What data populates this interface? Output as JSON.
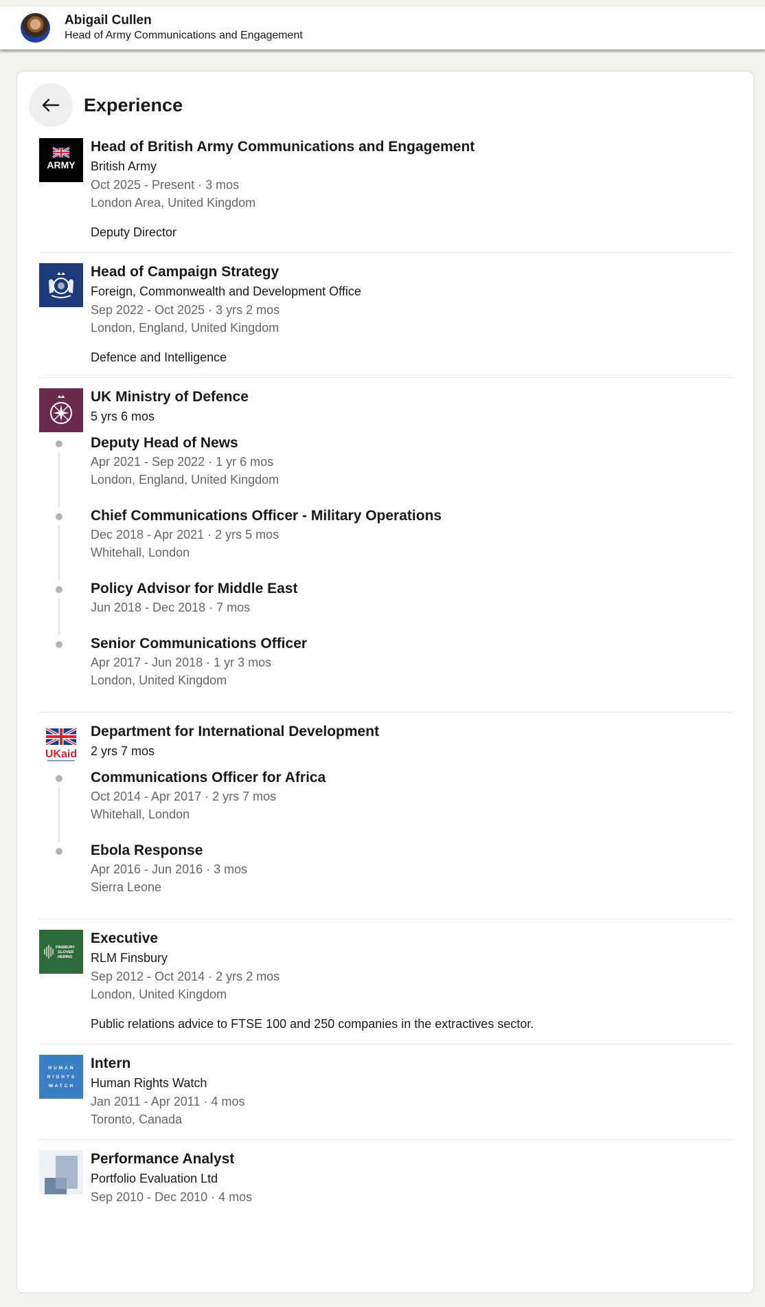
{
  "profile": {
    "name": "Abigail Cullen",
    "headline": "Head of Army Communications and Engagement"
  },
  "section": {
    "title": "Experience"
  },
  "experiences": [
    {
      "role": "Head of British Army Communications and Engagement",
      "company": "British Army",
      "dates": "Oct 2025 - Present · 3 mos",
      "location": "London Area, United Kingdom",
      "description": "Deputy Director",
      "logo_text": "ARMY"
    },
    {
      "role": "Head of Campaign Strategy",
      "company": "Foreign, Commonwealth and Development Office",
      "dates": "Sep 2022 - Oct 2025 · 3 yrs 2 mos",
      "location": "London, England, United Kingdom",
      "description": "Defence and Intelligence"
    },
    {
      "company": "UK Ministry of Defence",
      "duration": "5 yrs 6 mos",
      "positions": [
        {
          "role": "Deputy Head of News",
          "dates": "Apr 2021 - Sep 2022 · 1 yr 6 mos",
          "location": "London, England, United Kingdom"
        },
        {
          "role": "Chief Communications Officer - Military Operations",
          "dates": "Dec 2018 - Apr 2021 · 2 yrs 5 mos",
          "location": "Whitehall, London"
        },
        {
          "role": "Policy Advisor for Middle East",
          "dates": "Jun 2018 - Dec 2018 · 7 mos"
        },
        {
          "role": "Senior Communications Officer",
          "dates": "Apr 2017 - Jun 2018 · 1 yr 3 mos",
          "location": "London, United Kingdom"
        }
      ]
    },
    {
      "company": "Department for International Development",
      "duration": "2 yrs 7 mos",
      "logo_text": "UKaid",
      "positions": [
        {
          "role": "Communications Officer for Africa",
          "dates": "Oct 2014 - Apr 2017 · 2 yrs 7 mos",
          "location": "Whitehall, London"
        },
        {
          "role": "Ebola Response",
          "dates": "Apr 2016 - Jun 2016 · 3 mos",
          "location": "Sierra Leone"
        }
      ]
    },
    {
      "role": "Executive",
      "company": "RLM Finsbury",
      "dates": "Sep 2012 - Oct 2014 · 2 yrs 2 mos",
      "location": "London, United Kingdom",
      "description": "Public relations advice to FTSE 100 and 250 companies in the extractives sector.",
      "logo_text": [
        "FINSBURY",
        "GLOVER",
        "HERING"
      ]
    },
    {
      "role": "Intern",
      "company": "Human Rights Watch",
      "dates": "Jan 2011 - Apr 2011 · 4 mos",
      "location": "Toronto, Canada",
      "logo_text": [
        "HUMAN",
        "RIGHTS",
        "WATCH"
      ]
    },
    {
      "role": "Performance Analyst",
      "company": "Portfolio Evaluation Ltd",
      "dates": "Sep 2010 - Dec 2010 · 4 mos"
    }
  ],
  "colors": {
    "army_logo_bg": "#000000",
    "fcdo_logo_bg": "#1d3b7a",
    "mod_logo_bg": "#6a2b4a",
    "finsbury_logo_bg": "#2e6b3a",
    "hrw_logo_bg": "#3a7ec4",
    "ukaid_blue": "#1b3a8f",
    "ukaid_red": "#d62430",
    "timeline_dot": "#b3b3b3",
    "muted_text": "#666666"
  }
}
